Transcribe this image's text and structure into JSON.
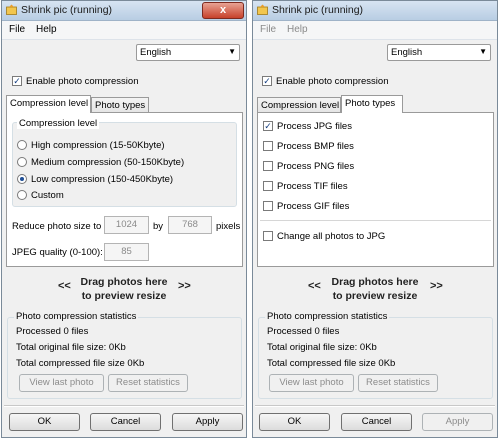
{
  "windows": [
    {
      "title": "Shrink pic (running)",
      "close_label": "x",
      "menu": {
        "file": "File",
        "help": "Help"
      },
      "language": "English",
      "enable_compression": {
        "label": "Enable photo compression",
        "checked": true
      },
      "tabs": [
        "Compression level",
        "Photo types"
      ],
      "active_tab": "Compression level",
      "compression_panel": {
        "group_title": "Compression level",
        "options": [
          {
            "label": "High compression (15-50Kbyte)",
            "selected": false
          },
          {
            "label": "Medium compression (50-150Kbyte)",
            "selected": false
          },
          {
            "label": "Low compression (150-450Kbyte)",
            "selected": true
          },
          {
            "label": "Custom",
            "selected": false
          }
        ],
        "reduce_label": "Reduce photo size to",
        "width": "1024",
        "by_label": "by",
        "height": "768",
        "pixels_label": "pixels",
        "jpeg_label": "JPEG quality (0-100):",
        "jpeg_value": "85"
      },
      "drop": {
        "left": "<<",
        "text": "Drag photos here",
        "text2": "to preview resize",
        "right": ">>"
      },
      "stats": {
        "title": "Photo compression statistics",
        "processed": "Processed 0 files",
        "original": "Total original file size: 0Kb",
        "compressed": "Total compressed file size 0Kb",
        "view_last": "View last photo",
        "reset": "Reset statistics"
      },
      "buttons": {
        "ok": "OK",
        "cancel": "Cancel",
        "apply": "Apply"
      }
    },
    {
      "title": "Shrink pic (running)",
      "close_label": "x",
      "menu": {
        "file": "File",
        "help": "Help"
      },
      "language": "English",
      "enable_compression": {
        "label": "Enable photo compression",
        "checked": true
      },
      "tabs": [
        "Compression level",
        "Photo types"
      ],
      "active_tab": "Photo types",
      "photo_types_panel": {
        "items": [
          {
            "label": "Process JPG files",
            "checked": true
          },
          {
            "label": "Process BMP files",
            "checked": false
          },
          {
            "label": "Process PNG files",
            "checked": false
          },
          {
            "label": "Process TIF files",
            "checked": false
          },
          {
            "label": "Process GIF files",
            "checked": false
          }
        ],
        "change_all": {
          "label": "Change all photos to JPG",
          "checked": false
        }
      },
      "drop": {
        "left": "<<",
        "text": "Drag photos here",
        "text2": "to preview resize",
        "right": ">>"
      },
      "stats": {
        "title": "Photo compression statistics",
        "processed": "Processed 0 files",
        "original": "Total original file size: 0Kb",
        "compressed": "Total compressed file size 0Kb",
        "view_last": "View last photo",
        "reset": "Reset statistics"
      },
      "buttons": {
        "ok": "OK",
        "cancel": "Cancel",
        "apply": "Apply"
      }
    }
  ],
  "icons": {
    "app": "shrink-pic-app-icon",
    "dropdown": "chevron-down-icon"
  },
  "colors": {
    "title_bar": "#c9d9ea",
    "close_button": "#c7412a",
    "checkbox_mark": "#163f80"
  }
}
